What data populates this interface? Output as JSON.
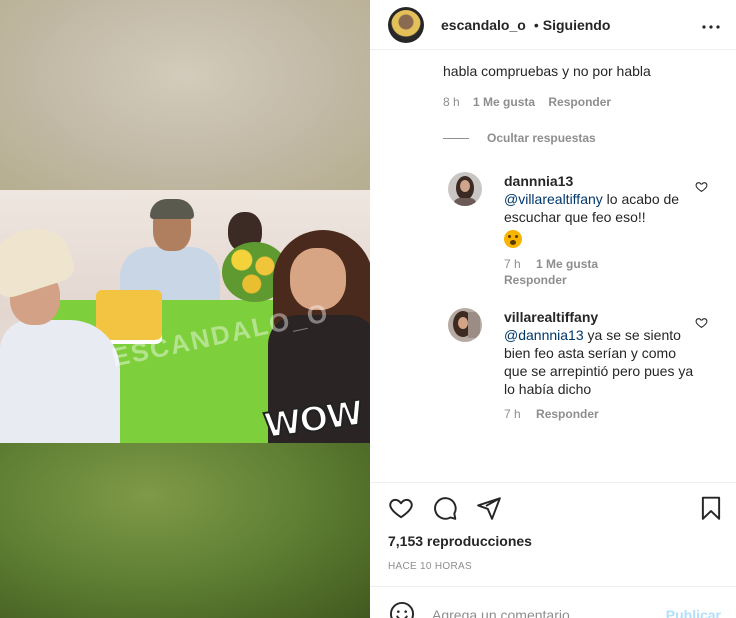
{
  "media": {
    "watermark": "ESCANDALO_O",
    "sticker": "WOW"
  },
  "header": {
    "username": "escandalo_o",
    "separator": "•",
    "follow_status": "Siguiendo",
    "more_icon": "more-horizontal-icon"
  },
  "previous_comment": {
    "text": "habla compruebas y no por habla",
    "time": "8 h",
    "likes": "1 Me gusta",
    "reply_label": "Responder"
  },
  "hide_replies_label": "Ocultar respuestas",
  "replies": [
    {
      "username": "dannnia13",
      "mention": "@villarealtiffany",
      "text": " lo acabo de escuchar que feo eso!!",
      "emoji": "astonished-face",
      "time": "7 h",
      "likes": "1 Me gusta",
      "reply_label": "Responder"
    },
    {
      "username": "villarealtiffany",
      "mention": "@dannnia13",
      "text": " ya se se siento bien feo asta serían y como que se arrepintió pero pues ya lo había dicho",
      "time": "7 h",
      "reply_label": "Responder"
    }
  ],
  "actions": {
    "icons": [
      "heart-icon",
      "comment-icon",
      "share-icon",
      "bookmark-icon"
    ],
    "views": "7,153 reproducciones",
    "time_ago": "HACE 10 HORAS"
  },
  "add_comment": {
    "placeholder": "Agrega un comentario...",
    "publish_label": "Publicar"
  }
}
